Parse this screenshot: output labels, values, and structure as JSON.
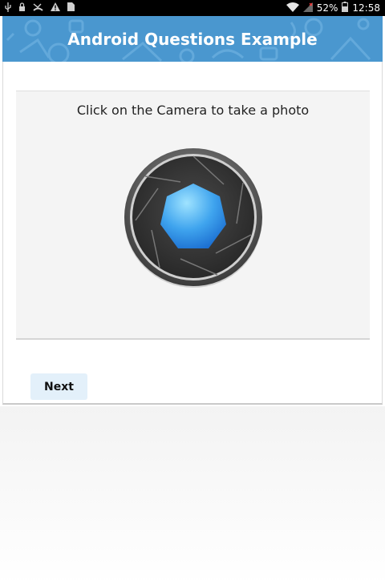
{
  "status_bar": {
    "icons_left": [
      "usb-icon",
      "lock-icon",
      "missed-call-icon",
      "warning-icon",
      "sd-card-icon"
    ],
    "icons_right": [
      "wifi-icon",
      "signal-icon",
      "battery-icon"
    ],
    "battery_percent": "52%",
    "time": "12:58"
  },
  "header": {
    "title": "Android Questions Example",
    "background_color": "#4a97cf"
  },
  "question": {
    "prompt": "Click on the Camera to take a photo",
    "camera_icon": "camera-shutter-icon"
  },
  "actions": {
    "next_label": "Next"
  }
}
